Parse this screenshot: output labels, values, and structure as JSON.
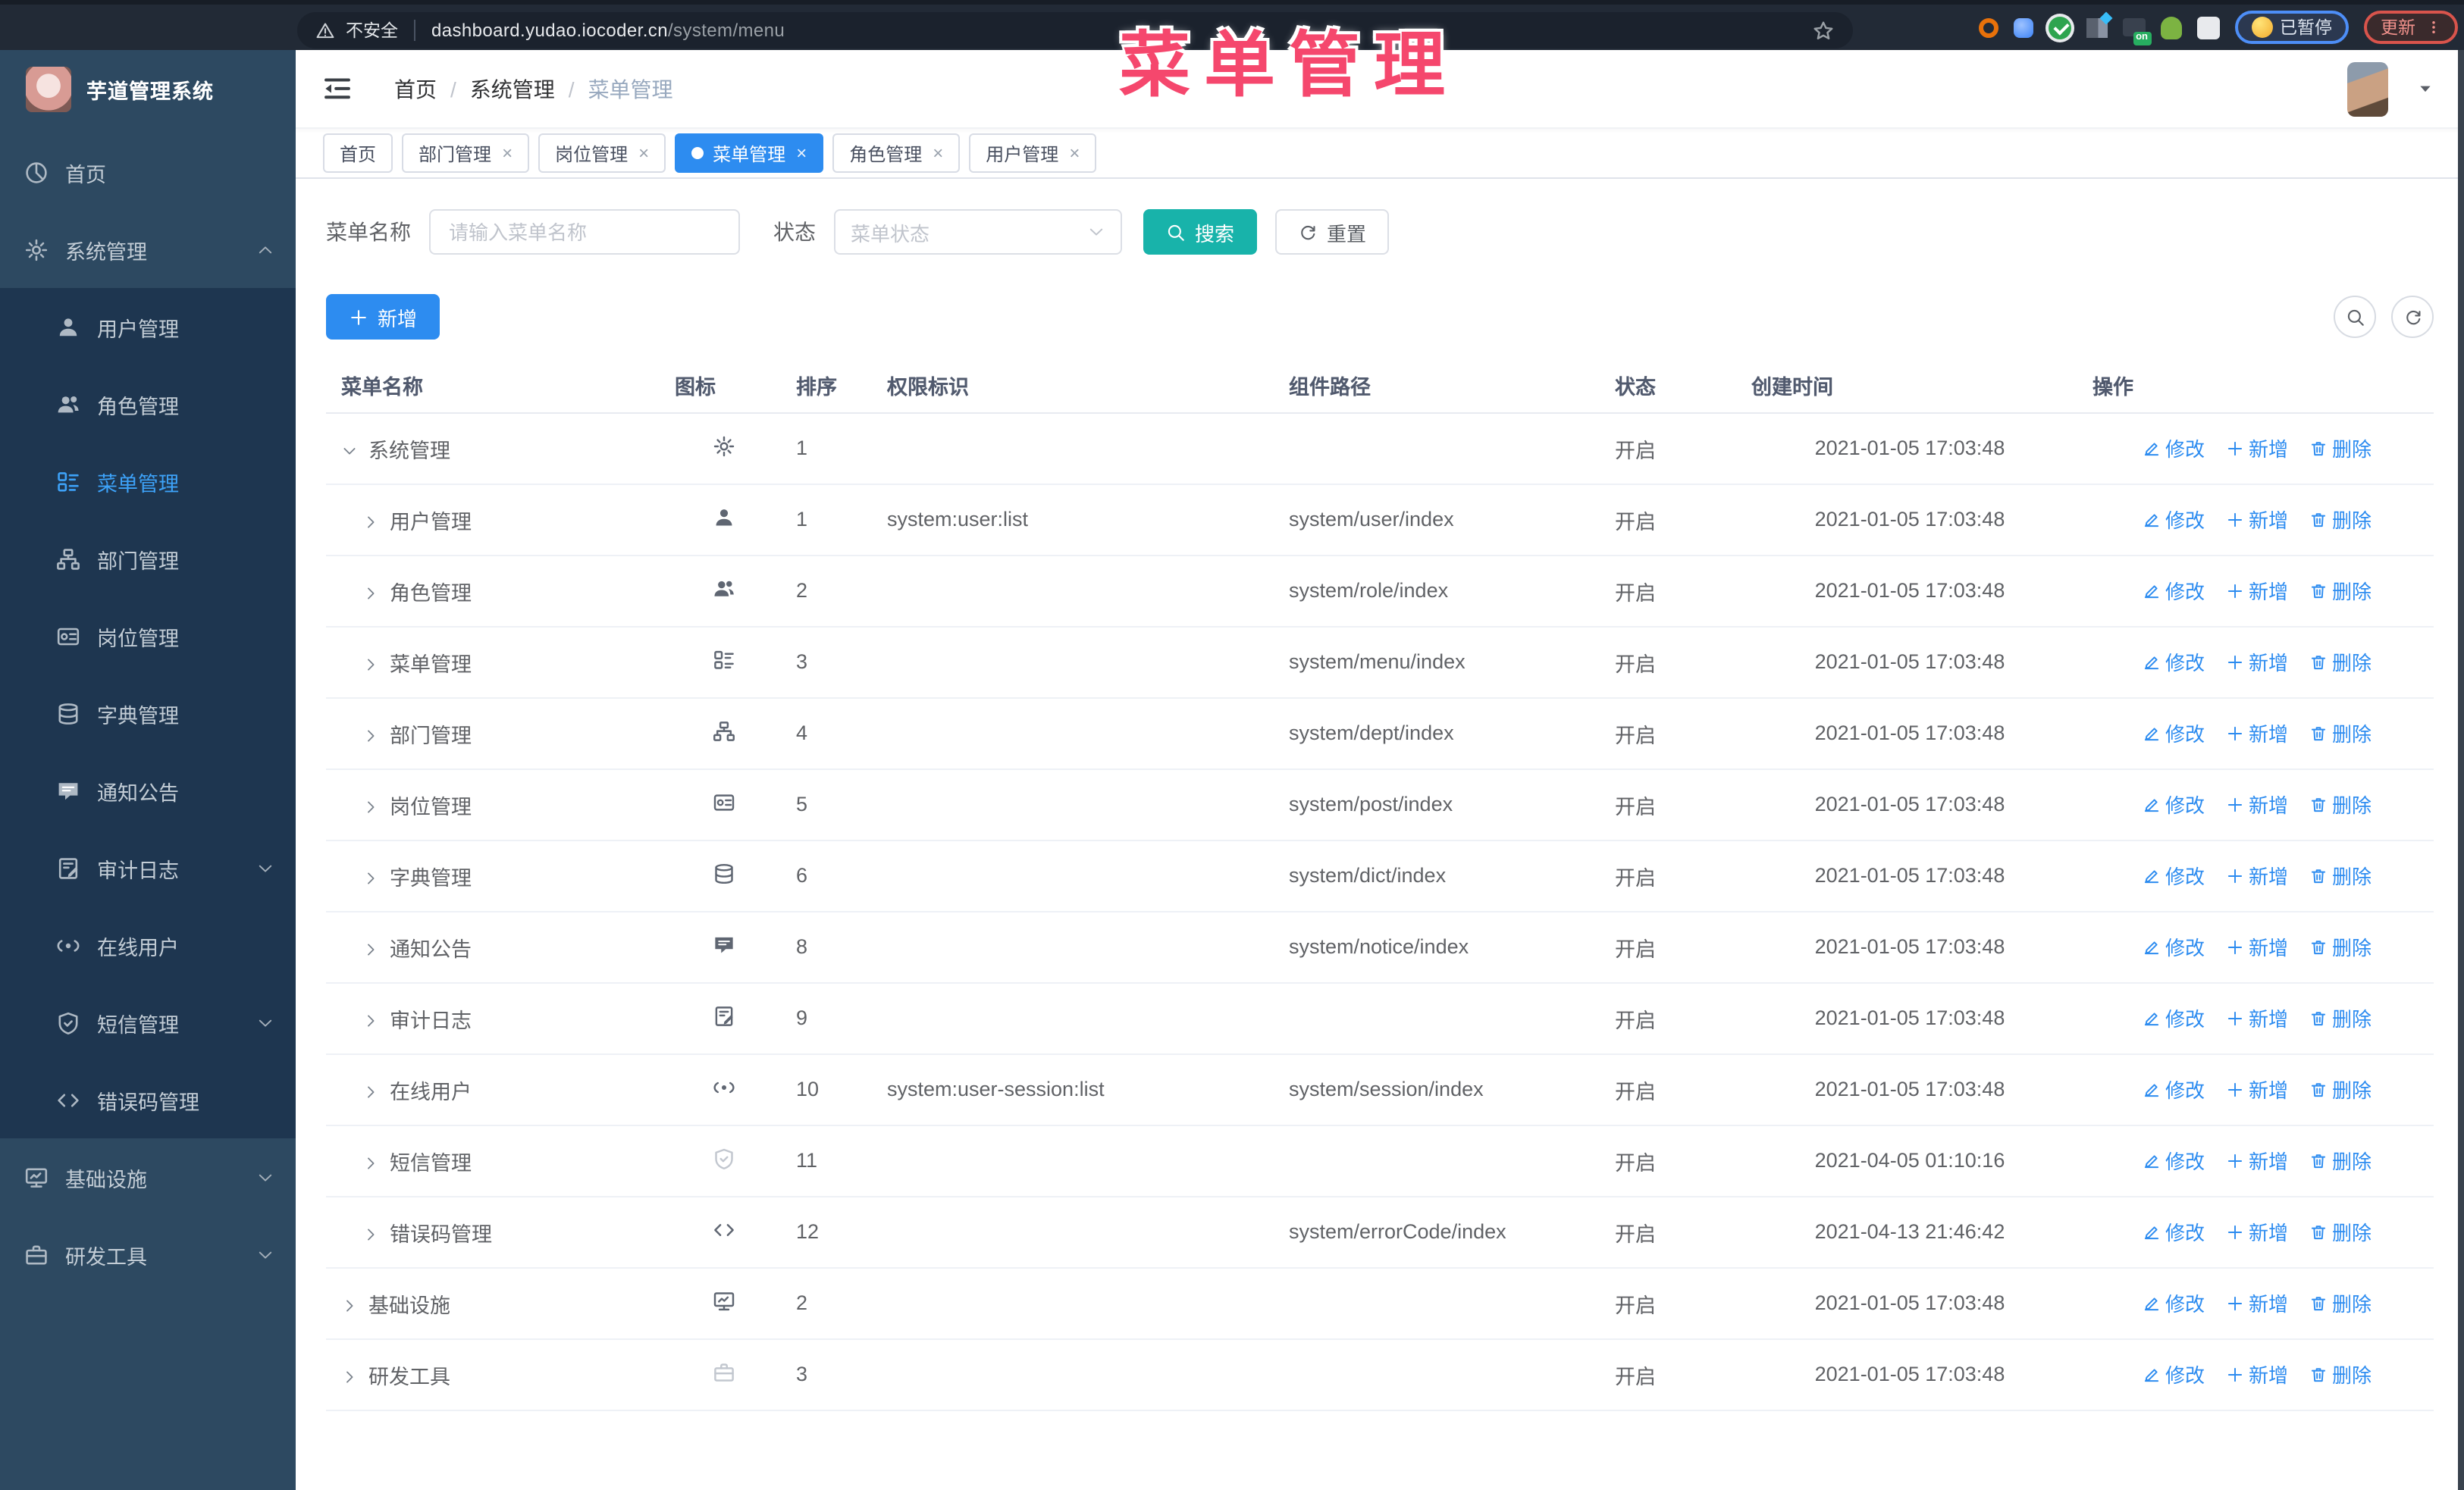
{
  "chrome": {
    "nav_buttons": [
      {
        "icon": "back",
        "name": "back-button"
      },
      {
        "icon": "forward",
        "name": "forward-button"
      },
      {
        "icon": "reload",
        "name": "reload-button"
      },
      {
        "icon": "home",
        "name": "home-button"
      }
    ],
    "security_label": "不安全",
    "url_host": "dashboard.yudao.iocoder.cn",
    "url_path": "/system/menu",
    "on_badge": "on",
    "paused_label": "已暂停",
    "update_label": "更新"
  },
  "annotation": {
    "text": "菜单管理",
    "color": "#f5476d"
  },
  "sidebar": {
    "logo_title": "芋道管理系统",
    "items": [
      {
        "icon": "dashboard",
        "label": "首页",
        "top": true
      },
      {
        "icon": "gear",
        "label": "系统管理",
        "top": true,
        "chevron": "chevron-up"
      },
      {
        "icon": "user",
        "label": "用户管理",
        "sub": true
      },
      {
        "icon": "users",
        "label": "角色管理",
        "sub": true
      },
      {
        "icon": "menu",
        "label": "菜单管理",
        "sub": true,
        "active": true
      },
      {
        "icon": "tree",
        "label": "部门管理",
        "sub": true
      },
      {
        "icon": "postcard",
        "label": "岗位管理",
        "sub": true
      },
      {
        "icon": "dict",
        "label": "字典管理",
        "sub": true
      },
      {
        "icon": "message",
        "label": "通知公告",
        "sub": true
      },
      {
        "icon": "log",
        "label": "审计日志",
        "sub": true,
        "chevron": "chevron-down"
      },
      {
        "icon": "online",
        "label": "在线用户",
        "sub": true
      },
      {
        "icon": "shield",
        "label": "短信管理",
        "sub": true,
        "chevron": "chevron-down"
      },
      {
        "icon": "code",
        "label": "错误码管理",
        "sub": true
      },
      {
        "icon": "monitor",
        "label": "基础设施",
        "top": true,
        "chevron": "chevron-down"
      },
      {
        "icon": "tool",
        "label": "研发工具",
        "top": true,
        "chevron": "chevron-down"
      }
    ]
  },
  "header": {
    "breadcrumb": [
      {
        "label": "首页",
        "sep": true
      },
      {
        "label": "系统管理",
        "sep": true
      },
      {
        "label": "菜单管理",
        "last": true
      }
    ],
    "breadcrumb_separator": "/",
    "icons": [
      {
        "icon": "search",
        "name": "search-icon"
      },
      {
        "icon": "github",
        "name": "github-icon"
      },
      {
        "icon": "help",
        "name": "help-icon"
      },
      {
        "icon": "fullscreen",
        "name": "fullscreen-icon"
      },
      {
        "icon": "fontsize",
        "name": "font-size-icon"
      }
    ]
  },
  "tabs_meta": {
    "close_glyph": "×"
  },
  "tabs": [
    {
      "label": "首页"
    },
    {
      "label": "部门管理",
      "closable": true
    },
    {
      "label": "岗位管理",
      "closable": true
    },
    {
      "label": "菜单管理",
      "closable": true,
      "active": true
    },
    {
      "label": "角色管理",
      "closable": true
    },
    {
      "label": "用户管理",
      "closable": true
    }
  ],
  "filter": {
    "name_label": "菜单名称",
    "name_placeholder": "请输入菜单名称",
    "status_label": "状态",
    "status_placeholder": "菜单状态",
    "search_label": "搜索",
    "reset_label": "重置"
  },
  "toolbar": {
    "add_label": "新增"
  },
  "table": {
    "columns": [
      "菜单名称",
      "图标",
      "排序",
      "权限标识",
      "组件路径",
      "状态",
      "创建时间",
      "操作"
    ],
    "actions": {
      "edit": "修改",
      "add": "新增",
      "delete": "删除"
    },
    "rows": [
      {
        "name": "系统管理",
        "caret": "expand-down",
        "icon": "gear",
        "sort": "1",
        "perm": "",
        "path": "",
        "status": "开启",
        "time": "2021-01-05 17:03:48"
      },
      {
        "name": "用户管理",
        "caret": "expand-right",
        "child": true,
        "icon": "user",
        "sort": "1",
        "perm": "system:user:list",
        "path": "system/user/index",
        "status": "开启",
        "time": "2021-01-05 17:03:48"
      },
      {
        "name": "角色管理",
        "caret": "expand-right",
        "child": true,
        "icon": "users",
        "sort": "2",
        "perm": "",
        "path": "system/role/index",
        "status": "开启",
        "time": "2021-01-05 17:03:48"
      },
      {
        "name": "菜单管理",
        "caret": "expand-right",
        "child": true,
        "icon": "menu",
        "sort": "3",
        "perm": "",
        "path": "system/menu/index",
        "status": "开启",
        "time": "2021-01-05 17:03:48"
      },
      {
        "name": "部门管理",
        "caret": "expand-right",
        "child": true,
        "icon": "tree",
        "sort": "4",
        "perm": "",
        "path": "system/dept/index",
        "status": "开启",
        "time": "2021-01-05 17:03:48"
      },
      {
        "name": "岗位管理",
        "caret": "expand-right",
        "child": true,
        "icon": "postcard",
        "sort": "5",
        "perm": "",
        "path": "system/post/index",
        "status": "开启",
        "time": "2021-01-05 17:03:48"
      },
      {
        "name": "字典管理",
        "caret": "expand-right",
        "child": true,
        "icon": "dict",
        "sort": "6",
        "perm": "",
        "path": "system/dict/index",
        "status": "开启",
        "time": "2021-01-05 17:03:48"
      },
      {
        "name": "通知公告",
        "caret": "expand-right",
        "child": true,
        "icon": "message",
        "sort": "8",
        "perm": "",
        "path": "system/notice/index",
        "status": "开启",
        "time": "2021-01-05 17:03:48"
      },
      {
        "name": "审计日志",
        "caret": "expand-right",
        "child": true,
        "icon": "log",
        "sort": "9",
        "perm": "",
        "path": "",
        "status": "开启",
        "time": "2021-01-05 17:03:48"
      },
      {
        "name": "在线用户",
        "caret": "expand-right",
        "child": true,
        "icon": "online",
        "sort": "10",
        "perm": "system:user-session:list",
        "path": "system/session/index",
        "status": "开启",
        "time": "2021-01-05 17:03:48"
      },
      {
        "name": "短信管理",
        "caret": "expand-right",
        "child": true,
        "light": true,
        "icon": "shield",
        "sort": "11",
        "perm": "",
        "path": "",
        "status": "开启",
        "time": "2021-04-05 01:10:16"
      },
      {
        "name": "错误码管理",
        "caret": "expand-right",
        "child": true,
        "icon": "code",
        "sort": "12",
        "perm": "",
        "path": "system/errorCode/index",
        "status": "开启",
        "time": "2021-04-13 21:46:42"
      },
      {
        "name": "基础设施",
        "caret": "expand-right",
        "icon": "monitor",
        "sort": "2",
        "perm": "",
        "path": "",
        "status": "开启",
        "time": "2021-01-05 17:03:48"
      },
      {
        "name": "研发工具",
        "caret": "expand-right",
        "light": true,
        "icon": "tool",
        "sort": "3",
        "perm": "",
        "path": "",
        "status": "开启",
        "time": "2021-01-05 17:03:48"
      }
    ]
  },
  "colors": {
    "accent_blue": "#2d8cf0",
    "teal_search": "#18b3aa",
    "sidebar_bg": "#2d4961",
    "submenu_bg": "#1e3650",
    "sidebar_active_text": "#3da2f8",
    "chrome_bg": "#222a36",
    "annotation_pink": "#f5476d",
    "paused_pill_border": "#4d8ef7",
    "update_pill_border": "#d9544c"
  }
}
